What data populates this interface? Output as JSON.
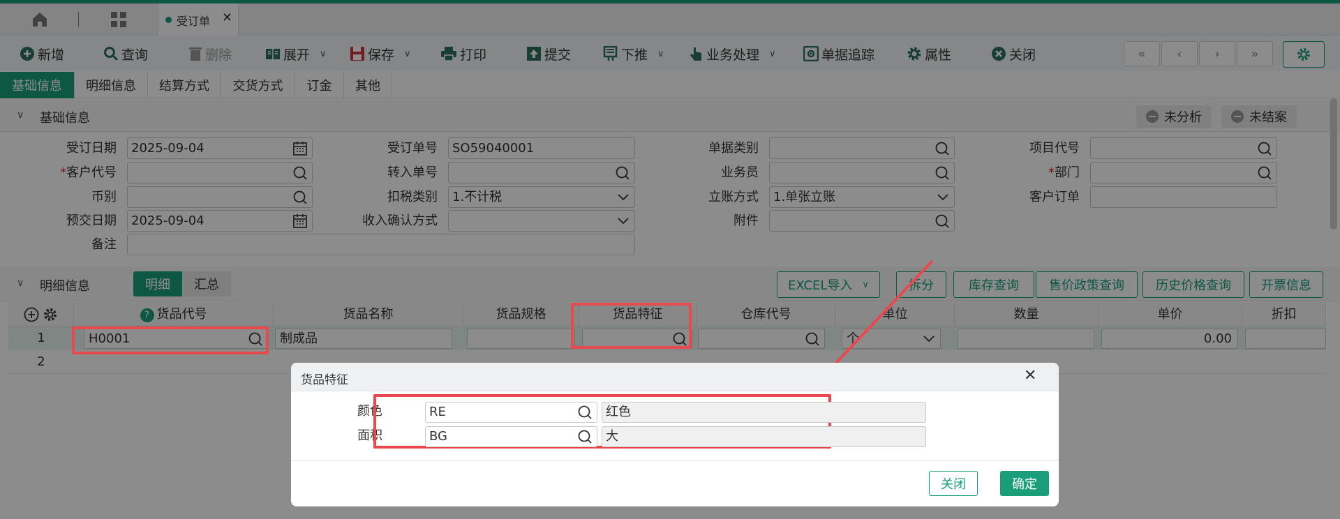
{
  "tabbar": {
    "doc_tab": "受订单",
    "close_glyph": "✕"
  },
  "toolbar": {
    "items": [
      "新增",
      "查询",
      "删除",
      "展开",
      "保存",
      "打印",
      "提交",
      "下推",
      "业务处理",
      "单据追踪",
      "属性",
      "关闭"
    ],
    "nav": [
      "«",
      "‹",
      "›",
      "»"
    ]
  },
  "subtabs": [
    "基础信息",
    "明细信息",
    "结算方式",
    "交货方式",
    "订金",
    "其他"
  ],
  "basic_section": {
    "title": "基础信息",
    "status": [
      "未分析",
      "未结案"
    ],
    "labels": {
      "order_date": "受订日期",
      "customer_code": "客户代号",
      "currency": "币别",
      "delivery_date": "预交日期",
      "remark": "备注",
      "order_no": "受订单号",
      "transfer_no": "转入单号",
      "tax_type": "扣税类别",
      "income_confirm": "收入确认方式",
      "doc_type": "单据类别",
      "salesman": "业务员",
      "account_method": "立账方式",
      "attachment": "附件",
      "project_code": "项目代号",
      "department": "部门",
      "customer_order": "客户订单"
    },
    "values": {
      "order_date": "2025-09-04",
      "delivery_date": "2025-09-04",
      "order_no": "SO59040001",
      "tax_type": "1.不计税",
      "account_method": "1.单张立账"
    },
    "required_mark": "*"
  },
  "detail_section": {
    "title": "明细信息",
    "toggle": [
      "明细",
      "汇总"
    ],
    "buttons": [
      "EXCEL导入",
      "拆分",
      "库存查询",
      "售价政策查询",
      "历史价格查询",
      "开票信息"
    ]
  },
  "grid": {
    "columns": [
      "货品代号",
      "货品名称",
      "货品规格",
      "货品特征",
      "仓库代号",
      "单位",
      "数量",
      "单价",
      "折扣"
    ],
    "rows": [
      {
        "no": "1",
        "code": "H0001",
        "name": "制成品",
        "unit": "个",
        "price": "0.00"
      },
      {
        "no": "2"
      }
    ]
  },
  "dialog": {
    "title": "货品特征",
    "rows": [
      {
        "label": "颜色",
        "code": "RE",
        "name": "红色"
      },
      {
        "label": "面积",
        "code": "BG",
        "name": "大"
      }
    ],
    "close_label": "关闭",
    "ok_label": "确定"
  },
  "colors": {
    "accent": "#1a9e7a",
    "highlight": "#e8494f",
    "required": "#d9302c"
  },
  "icons": {
    "toolbar": [
      "plus-circle-icon",
      "search-icon",
      "trash-icon",
      "expand-book-icon",
      "save-icon",
      "printer-icon",
      "submit-icon",
      "push-down-icon",
      "hand-pointer-icon",
      "trace-icon",
      "gear-icon",
      "close-circle-icon"
    ]
  }
}
